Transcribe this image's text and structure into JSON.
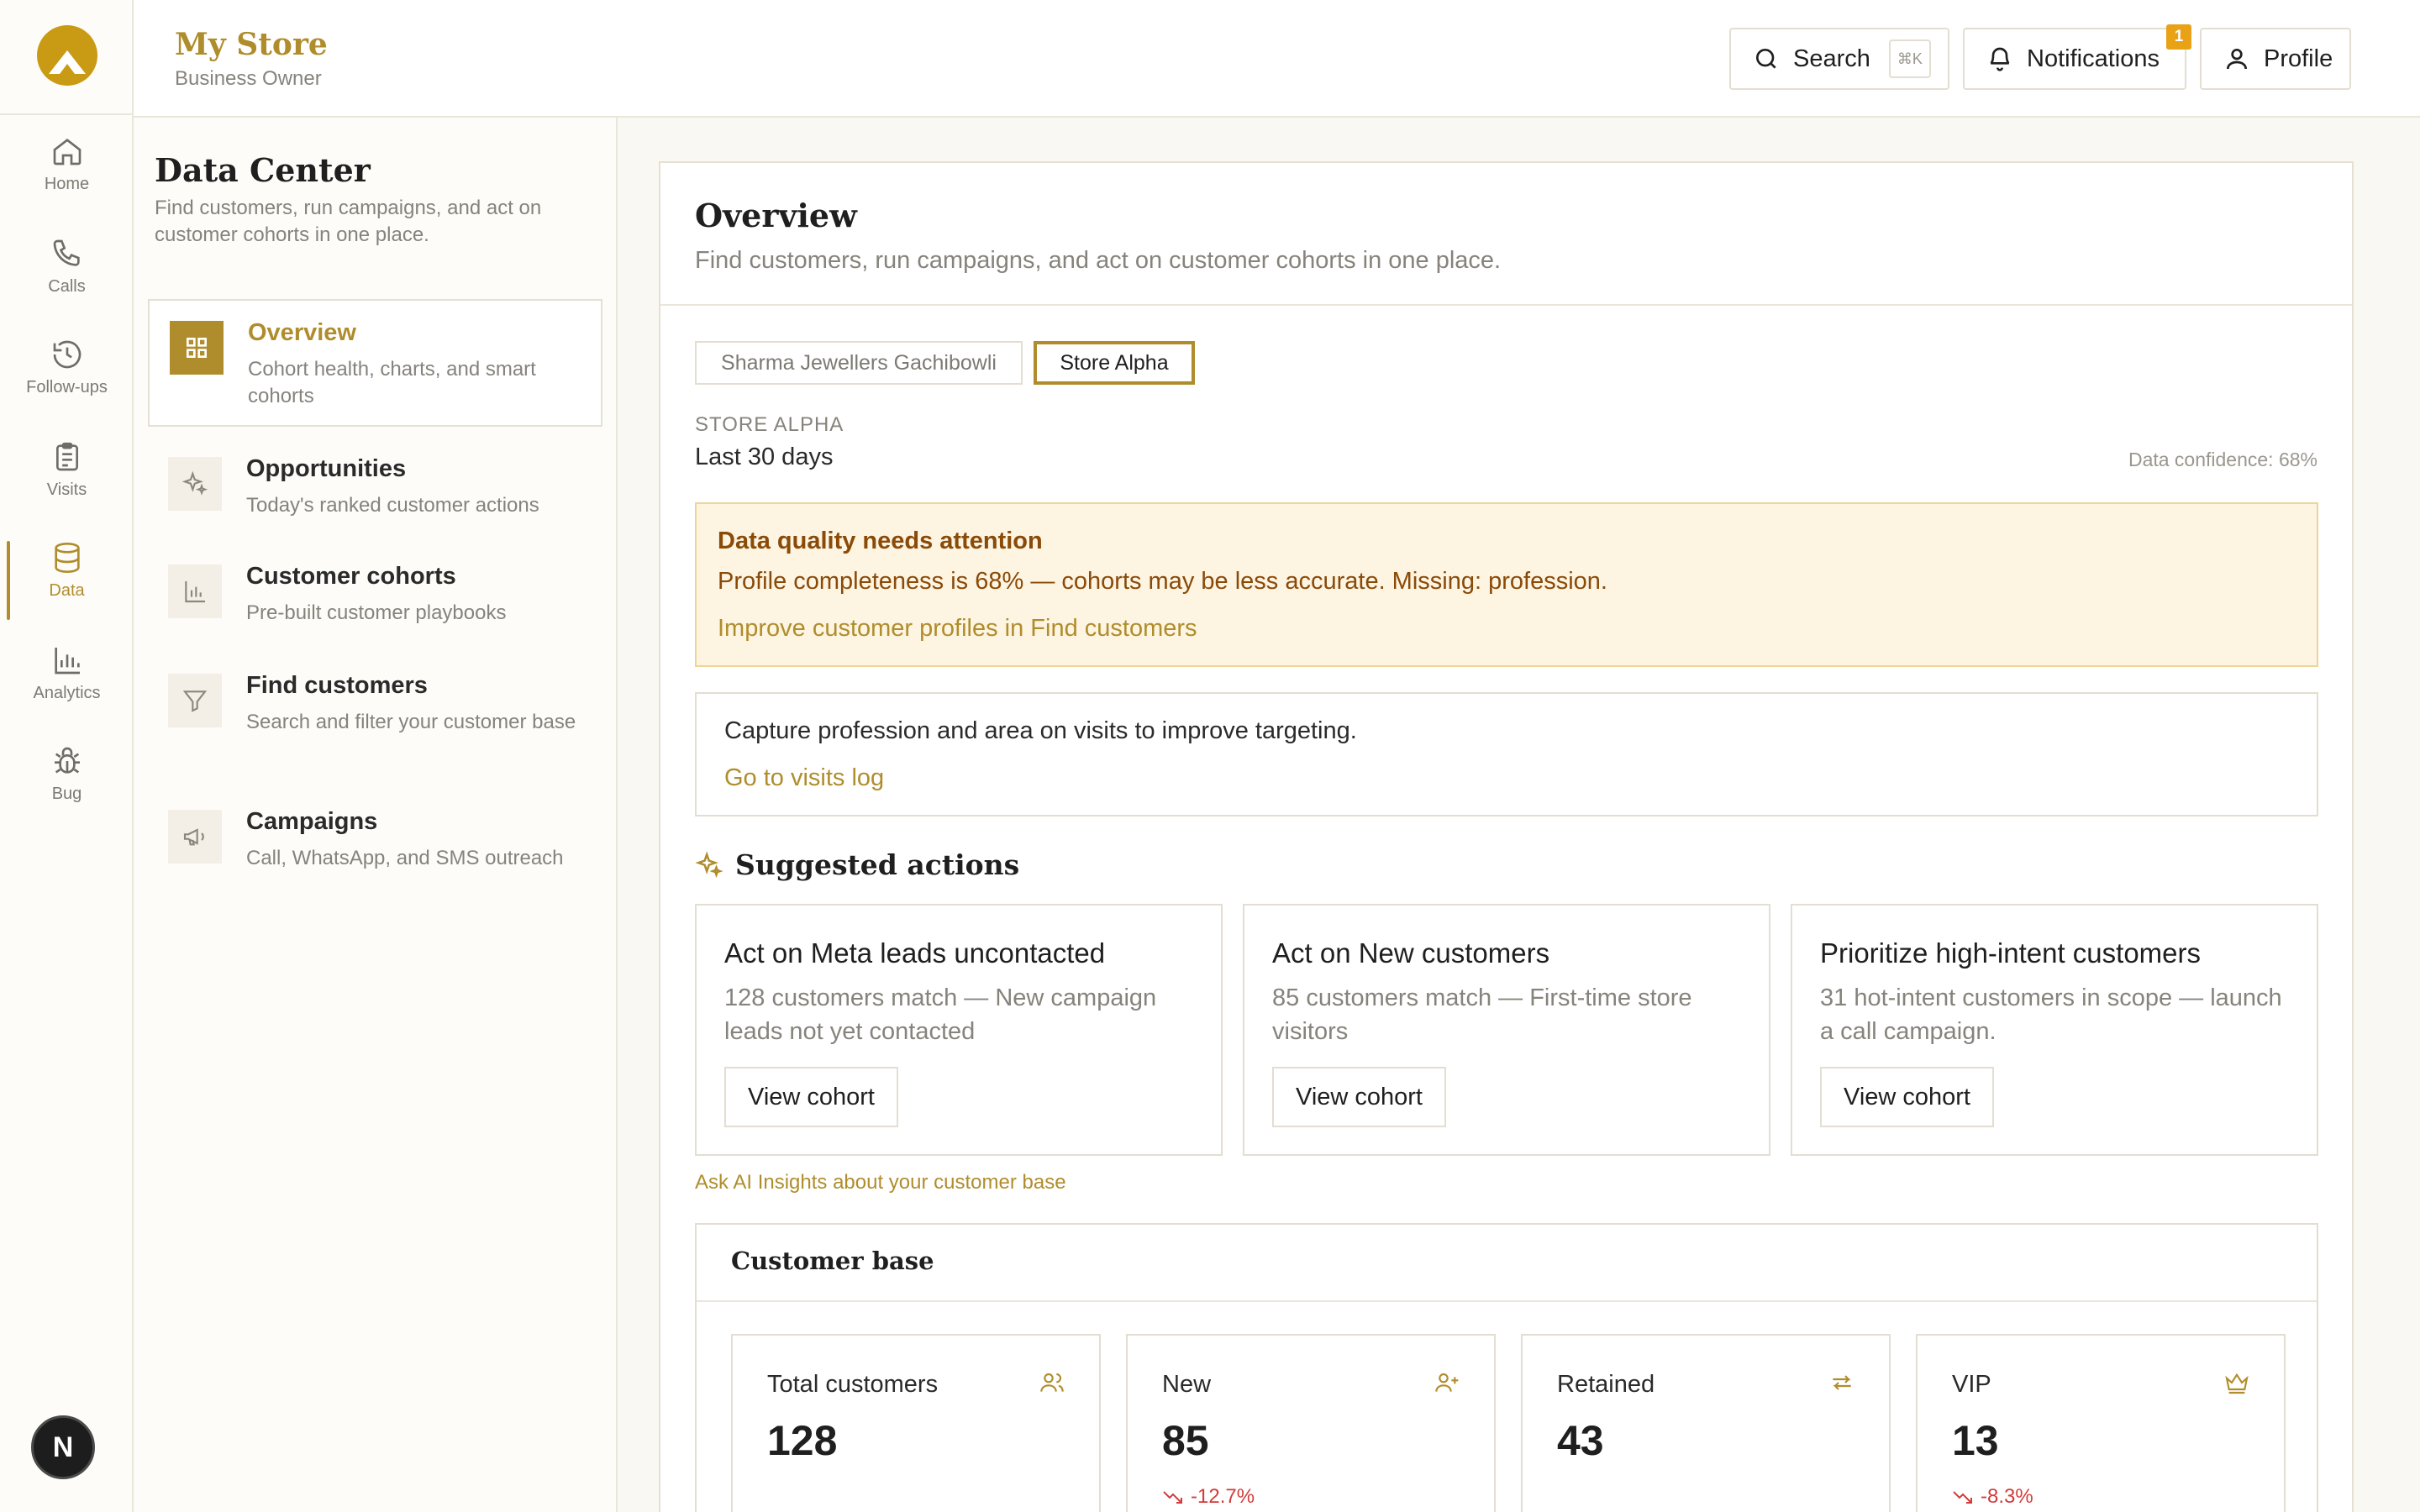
{
  "rail": {
    "items": [
      {
        "label": "Home"
      },
      {
        "label": "Calls"
      },
      {
        "label": "Follow-ups"
      },
      {
        "label": "Visits"
      },
      {
        "label": "Data"
      },
      {
        "label": "Analytics"
      },
      {
        "label": "Bug"
      }
    ],
    "avatar": "N"
  },
  "header": {
    "store_name": "My Store",
    "store_role": "Business Owner",
    "search_label": "Search",
    "search_shortcut": "⌘K",
    "notifications_label": "Notifications",
    "notifications_count": "1",
    "profile_label": "Profile"
  },
  "sidebar": {
    "title": "Data Center",
    "subtitle": "Find customers, run campaigns, and act on customer cohorts in one place.",
    "items": [
      {
        "title": "Overview",
        "desc": "Cohort health, charts, and smart cohorts"
      },
      {
        "title": "Opportunities",
        "desc": "Today's ranked customer actions"
      },
      {
        "title": "Customer cohorts",
        "desc": "Pre-built customer playbooks"
      },
      {
        "title": "Find customers",
        "desc": "Search and filter your customer base"
      },
      {
        "title": "Campaigns",
        "desc": "Call, WhatsApp, and SMS outreach"
      }
    ]
  },
  "main": {
    "title": "Overview",
    "subtitle": "Find customers, run campaigns, and act on customer cohorts in one place.",
    "store_tabs": [
      "Sharma Jewellers Gachibowli",
      "Store Alpha"
    ],
    "scope_label": "STORE ALPHA",
    "period": "Last 30 days",
    "confidence": "Data confidence: 68%",
    "alert": {
      "heading": "Data quality needs attention",
      "body": "Profile completeness is 68% — cohorts may be less accurate. Missing: profession.",
      "link": "Improve customer profiles in Find customers"
    },
    "tip": {
      "body": "Capture profession and area on visits to improve targeting.",
      "link": "Go to visits log"
    },
    "suggested": {
      "title": "Suggested actions",
      "cards": [
        {
          "title": "Act on Meta leads uncontacted",
          "desc": "128 customers match — New campaign leads not yet contacted",
          "button": "View cohort"
        },
        {
          "title": "Act on New customers",
          "desc": "85 customers match — First-time store visitors",
          "button": "View cohort"
        },
        {
          "title": "Prioritize high-intent customers",
          "desc": "31 hot-intent customers in scope — launch a call campaign.",
          "button": "View cohort"
        }
      ],
      "ask_link": "Ask AI Insights about your customer base"
    },
    "customer_base": {
      "title": "Customer base",
      "stats": [
        {
          "label": "Total customers",
          "value": "128",
          "change": ""
        },
        {
          "label": "New",
          "value": "85",
          "change": "-12.7%"
        },
        {
          "label": "Retained",
          "value": "43",
          "change": ""
        },
        {
          "label": "VIP",
          "value": "13",
          "change": "-8.3%"
        }
      ]
    }
  },
  "colors": {
    "accent": "#b08d2c",
    "logo": "#c99a14",
    "alert_bg": "#fdf4e2",
    "alert_text": "#8a4a08",
    "negative": "#d23b3b",
    "badge": "#e9a216"
  }
}
